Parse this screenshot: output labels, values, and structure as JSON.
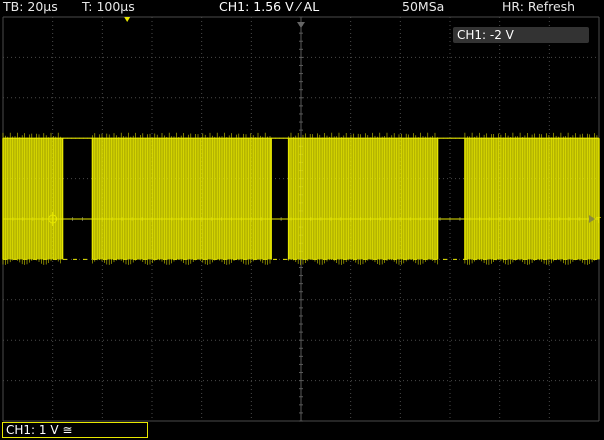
{
  "status_bar": {
    "timebase": "TB: 20µs",
    "trigger_time": "T: 100µs",
    "trigger_channel": "CH1: 1.56 V ⁄ AL",
    "sample_rate": "50MSa",
    "acquisition_mode": "HR: Refresh"
  },
  "channel_offset_label": "CH1: -2 V",
  "channel_scale_label": "CH1: 1 V ≅",
  "colors": {
    "channel1": "#e8e800",
    "grid": "#4a4a4a",
    "background": "#000000",
    "marker_dim": "#8a8a40"
  },
  "trace": {
    "type": "burst-square-wave",
    "high_level_div": 2.0,
    "low_level_div": -1.0,
    "bursts_time_div": [
      [
        0.0,
        1.2
      ],
      [
        1.8,
        5.4
      ],
      [
        5.75,
        8.75
      ],
      [
        9.3,
        12.0
      ]
    ],
    "burst_x_range_div": [
      0,
      12
    ]
  },
  "markers": {
    "trigger_position_icon": "down-triangle-icon",
    "ground_level_icon": "circle-crosshair-icon",
    "trigger_level_icon": "right-triangle-t-icon"
  }
}
